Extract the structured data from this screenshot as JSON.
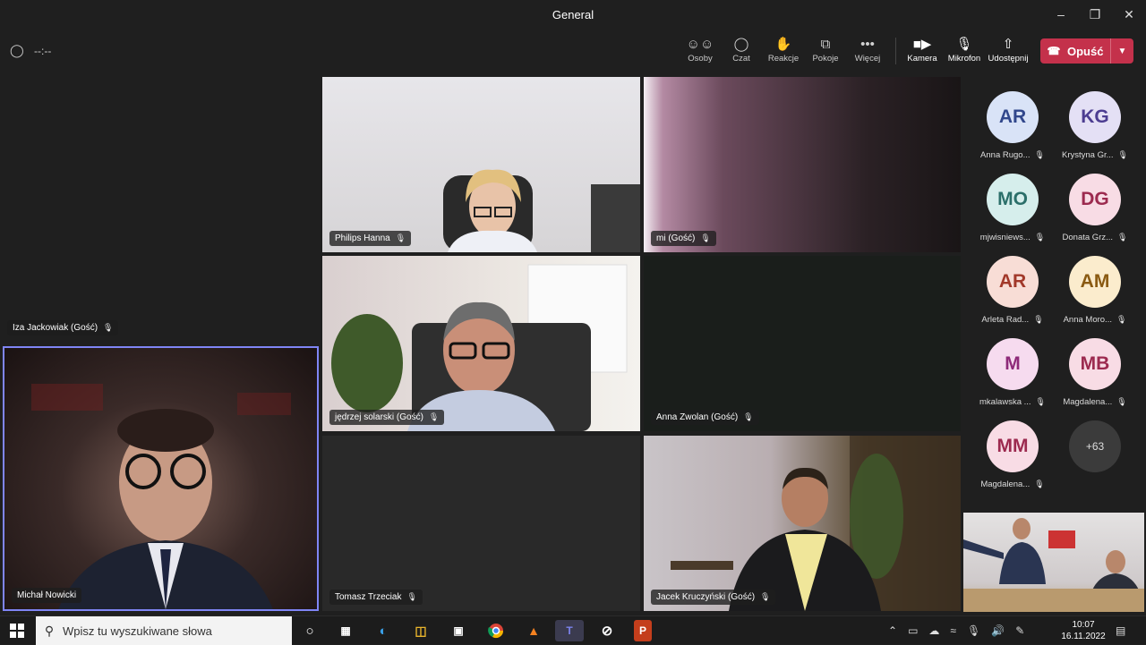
{
  "window": {
    "title": "General"
  },
  "toolbar": {
    "timer": "--:--",
    "buttons": {
      "people": "Osoby",
      "chat": "Czat",
      "reactions": "Reakcje",
      "rooms": "Pokoje",
      "more": "Więcej",
      "camera": "Kamera",
      "mic": "Mikrofon",
      "share": "Udostępnij"
    },
    "leave": "Opuść"
  },
  "tiles": {
    "iza": "Iza Jackowiak (Gość)",
    "michal": "Michał Nowicki",
    "philips": "Philips Hanna",
    "mi": "mi (Gość)",
    "jedrzej": "jędrzej solarski (Gość)",
    "anna_zwolan": "Anna Zwolan (Gość)",
    "tomasz": "Tomasz Trzeciak",
    "jacek": "Jacek Kruczyński (Gość)"
  },
  "rail": [
    {
      "initials": "AR",
      "name": "Anna Rugo...",
      "bg": "#d9e3f7",
      "fg": "#31478c"
    },
    {
      "initials": "KG",
      "name": "Krystyna Gr...",
      "bg": "#e4e0f5",
      "fg": "#4c3d91"
    },
    {
      "initials": "MO",
      "name": "mjwisniews...",
      "bg": "#d6eeec",
      "fg": "#2b6f6a"
    },
    {
      "initials": "DG",
      "name": "Donata Grz...",
      "bg": "#f8dce5",
      "fg": "#9c2a4f"
    },
    {
      "initials": "AR",
      "name": "Arleta Rad...",
      "bg": "#f8ddd6",
      "fg": "#a2382a"
    },
    {
      "initials": "AM",
      "name": "Anna Moro...",
      "bg": "#fbeccd",
      "fg": "#8a5a12"
    },
    {
      "initials": "M",
      "name": "mkalawska ...",
      "bg": "#f6dbef",
      "fg": "#8e2a79"
    },
    {
      "initials": "MB",
      "name": "Magdalena...",
      "bg": "#f8dce5",
      "fg": "#9c2a4f"
    },
    {
      "initials": "MM",
      "name": "Magdalena...",
      "bg": "#f8dce5",
      "fg": "#9c2a4f"
    }
  ],
  "rail_more": "+63",
  "taskbar": {
    "search_placeholder": "Wpisz tu wyszukiwane słowa",
    "time": "10:07",
    "date": "16.11.2022"
  }
}
